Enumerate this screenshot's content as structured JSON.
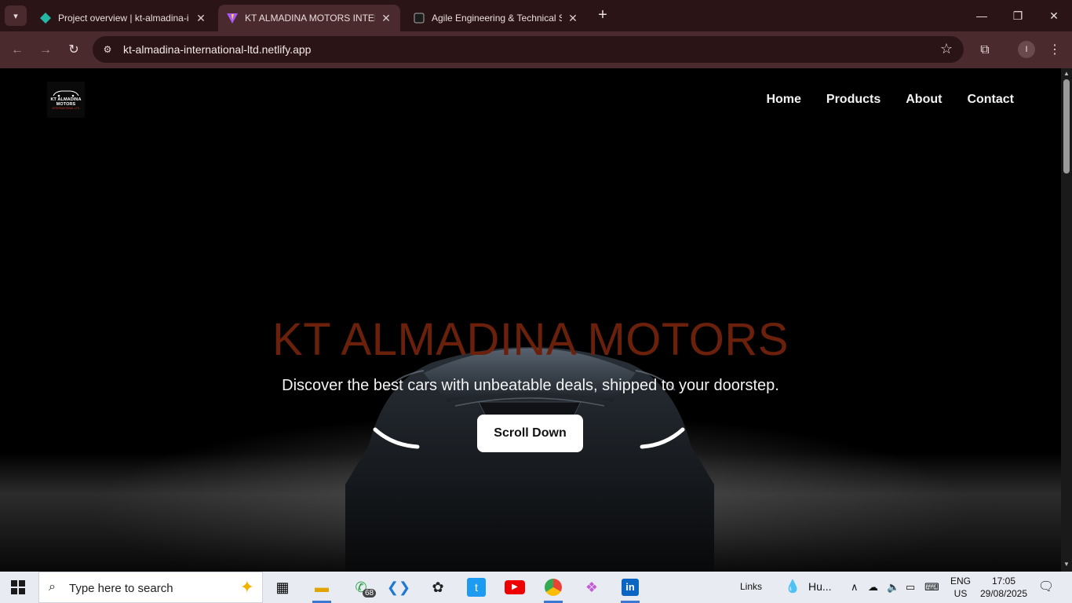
{
  "browser": {
    "tabs": [
      {
        "title": "Project overview | kt-almadina-i",
        "active": false
      },
      {
        "title": "KT ALMADINA MOTORS INTERN",
        "active": true
      },
      {
        "title": "Agile Engineering & Technical S",
        "active": false
      }
    ],
    "url": "kt-almadina-international-ltd.netlify.app",
    "profile_initial": "I"
  },
  "site": {
    "logo": {
      "line1": "KT ALMADINA",
      "line2": "MOTORS",
      "line3": "INTERNATIONAL LTD"
    },
    "nav": [
      "Home",
      "Products",
      "About",
      "Contact"
    ],
    "hero": {
      "title": "KT ALMADINA MOTORS",
      "subtitle": "Discover the best cars with unbeatable deals, shipped to your doorstep.",
      "cta": "Scroll Down"
    }
  },
  "taskbar": {
    "search_placeholder": "Type here to search",
    "whatsapp_badge": "68",
    "links_label": "Links",
    "weather": "Hu...",
    "lang_top": "ENG",
    "lang_bottom": "US",
    "time": "17:05",
    "date": "29/08/2025"
  },
  "colors": {
    "chrome_dark": "#2b1416",
    "chrome_mid": "#4a2a2d",
    "hero_title": "#6b200c",
    "cta_bg": "#ffffff"
  }
}
